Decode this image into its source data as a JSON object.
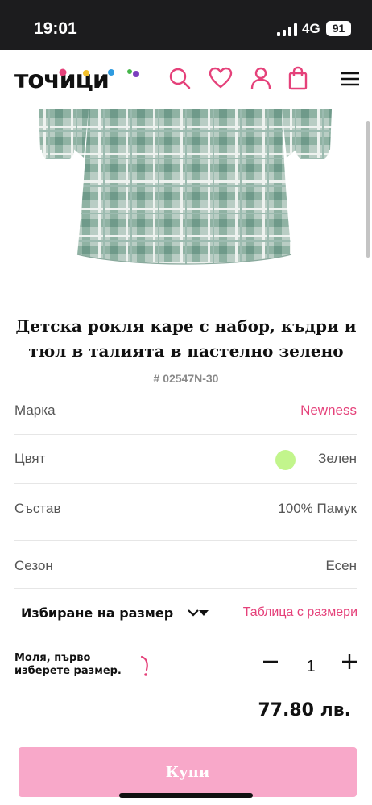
{
  "status_bar": {
    "time": "19:01",
    "network": "4G",
    "battery": "91"
  },
  "header": {
    "logo_text": "тoчици",
    "icons": [
      "search-icon",
      "heart-icon",
      "user-icon",
      "bag-icon",
      "menu-icon"
    ],
    "accent": "#e5417a"
  },
  "product": {
    "title": "Детска рокля каре с набор, къдри и тюл в талията в пастелно зелено",
    "sku": "# 02547N-30",
    "details": [
      {
        "label": "Марка",
        "value": "Newness"
      },
      {
        "label": "Цвят",
        "value": "Зелен",
        "swatch": "#c2f58c"
      },
      {
        "label": "Състав",
        "value": "100% Памук"
      },
      {
        "label": "Сезон",
        "value": "Есен"
      }
    ]
  },
  "size": {
    "select_label": "Избиране на размер",
    "table_link": "Таблица с размери",
    "warning": "Моля, първо изберете размер."
  },
  "quantity": {
    "value": "1"
  },
  "price": "77.80 лв.",
  "buy_button": {
    "label": "Купи",
    "color": "#f8a8c9"
  }
}
